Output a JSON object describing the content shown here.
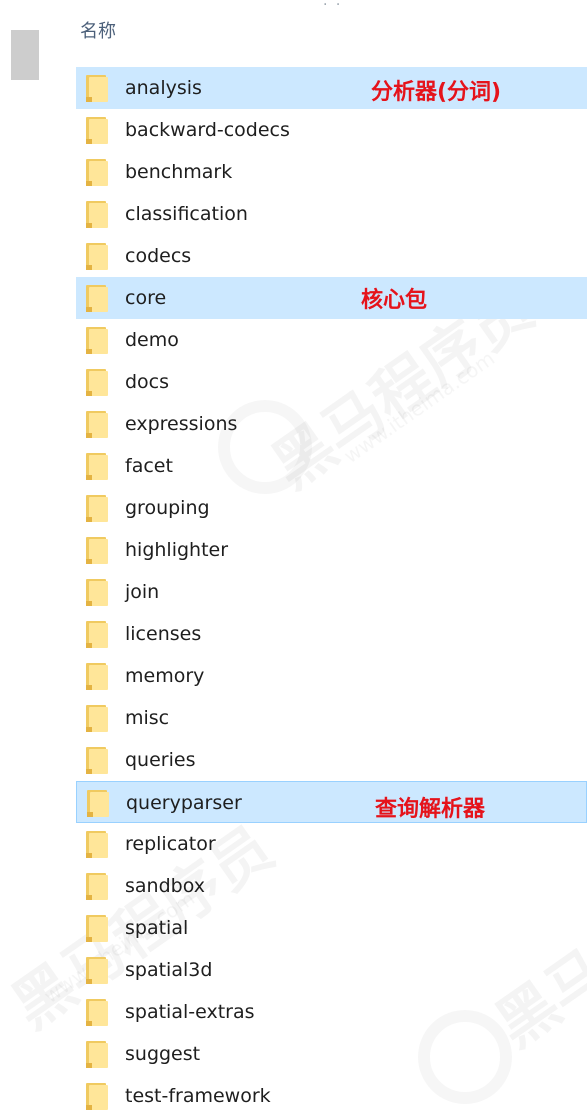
{
  "header": {
    "name_column": "名称",
    "dots": "· ·"
  },
  "files": [
    {
      "name": "analysis"
    },
    {
      "name": "backward-codecs"
    },
    {
      "name": "benchmark"
    },
    {
      "name": "classification"
    },
    {
      "name": "codecs"
    },
    {
      "name": "core"
    },
    {
      "name": "demo"
    },
    {
      "name": "docs"
    },
    {
      "name": "expressions"
    },
    {
      "name": "facet"
    },
    {
      "name": "grouping"
    },
    {
      "name": "highlighter"
    },
    {
      "name": "join"
    },
    {
      "name": "licenses"
    },
    {
      "name": "memory"
    },
    {
      "name": "misc"
    },
    {
      "name": "queries"
    },
    {
      "name": "queryparser"
    },
    {
      "name": "replicator"
    },
    {
      "name": "sandbox"
    },
    {
      "name": "spatial"
    },
    {
      "name": "spatial3d"
    },
    {
      "name": "spatial-extras"
    },
    {
      "name": "suggest"
    },
    {
      "name": "test-framework"
    }
  ],
  "annotations": {
    "analysis": "分析器(分词)",
    "core": "核心包",
    "queryparser": "查询解析器"
  },
  "watermark": {
    "brand": "黑马程序员",
    "site": "www.itheima.com"
  },
  "colors": {
    "selection": "#cce8ff",
    "selection_border": "#99d1ff",
    "annotation": "#e5131b",
    "folder": "#ffe699"
  },
  "icon_names": {
    "folder": "folder-icon"
  }
}
